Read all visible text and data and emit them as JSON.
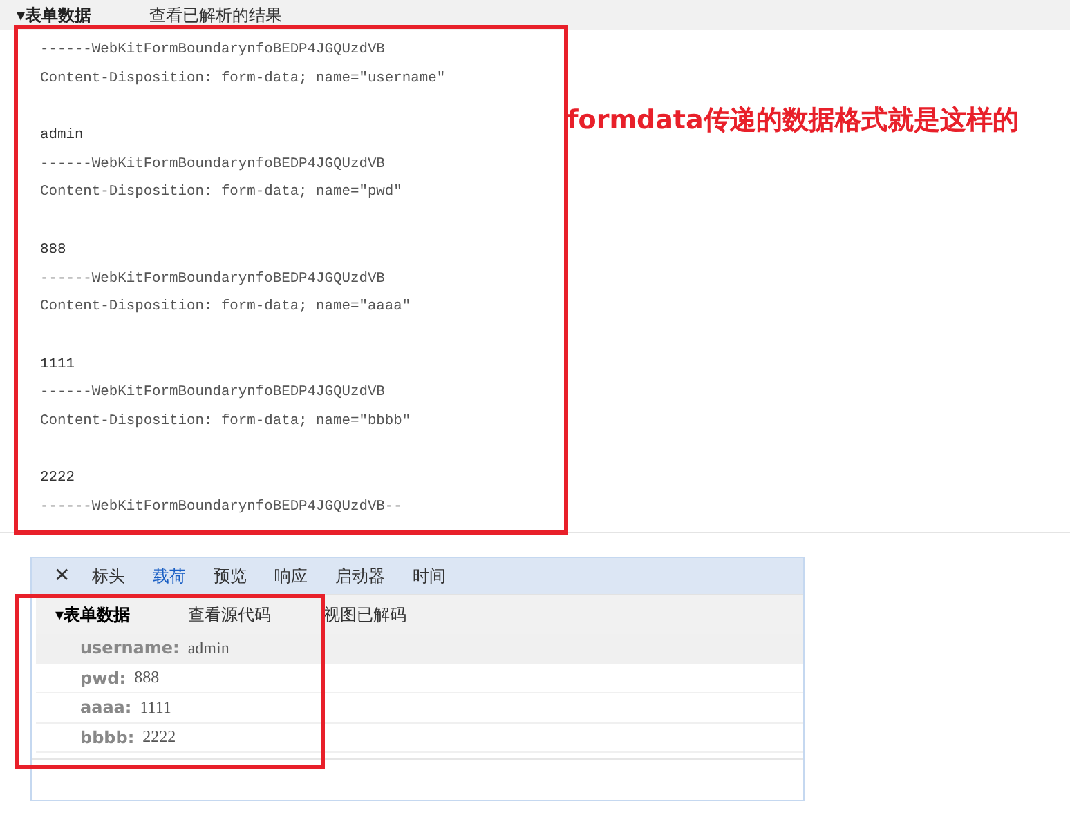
{
  "raw_view": {
    "header": {
      "toggle": "▾",
      "title": "表单数据",
      "link": "查看已解析的结果"
    },
    "parts": [
      {
        "boundary": "------WebKitFormBoundarynfoBEDP4JGQUzdVB",
        "disposition": "Content-Disposition: form-data; name=\"username\"",
        "value": "admin"
      },
      {
        "boundary": "------WebKitFormBoundarynfoBEDP4JGQUzdVB",
        "disposition": "Content-Disposition: form-data; name=\"pwd\"",
        "value": "888"
      },
      {
        "boundary": "------WebKitFormBoundarynfoBEDP4JGQUzdVB",
        "disposition": "Content-Disposition: form-data; name=\"aaaa\"",
        "value": "1111"
      },
      {
        "boundary": "------WebKitFormBoundarynfoBEDP4JGQUzdVB",
        "disposition": "Content-Disposition: form-data; name=\"bbbb\"",
        "value": "2222"
      }
    ],
    "closing_boundary": "------WebKitFormBoundarynfoBEDP4JGQUzdVB--"
  },
  "annotation": "formdata传递的数据格式就是这样的",
  "devtools_panel": {
    "close": "✕",
    "tabs": [
      {
        "label": "标头",
        "selected": false
      },
      {
        "label": "载荷",
        "selected": true
      },
      {
        "label": "预览",
        "selected": false
      },
      {
        "label": "响应",
        "selected": false
      },
      {
        "label": "启动器",
        "selected": false
      },
      {
        "label": "时间",
        "selected": false
      }
    ],
    "header": {
      "toggle": "▾",
      "title": "表单数据",
      "links": [
        "查看源代码",
        "视图已解码"
      ]
    },
    "fields": [
      {
        "name": "username:",
        "value": "admin",
        "selected": true
      },
      {
        "name": "pwd:",
        "value": "888",
        "selected": false
      },
      {
        "name": "aaaa:",
        "value": "1111",
        "selected": false
      },
      {
        "name": "bbbb:",
        "value": "2222",
        "selected": false
      }
    ]
  }
}
